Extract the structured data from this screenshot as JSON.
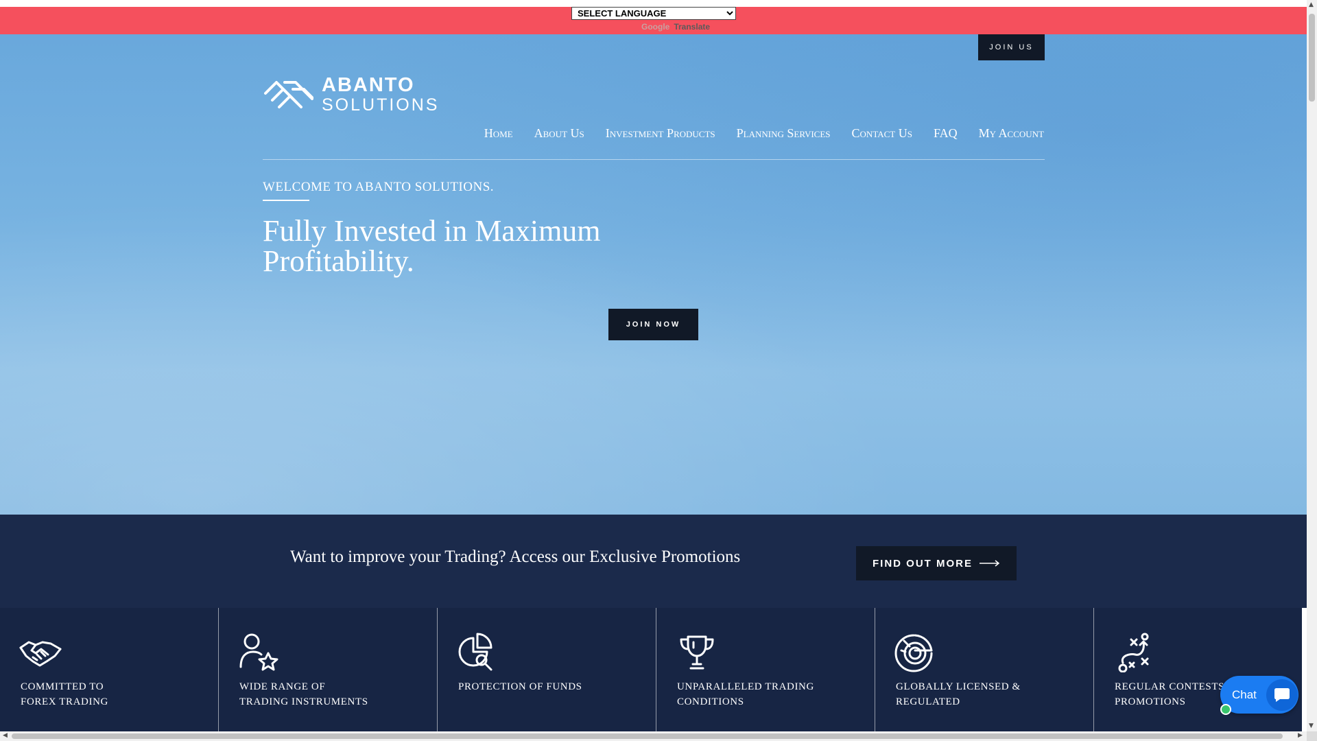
{
  "translate": {
    "select_value": "SELECT LANGUAGE",
    "powered_prefix": "Google",
    "powered_label": "Translate"
  },
  "header": {
    "join_us": "JOIN US",
    "logo_line1": "ABANTO",
    "logo_line2": "SOLUTIONS",
    "nav": [
      "Home",
      "About Us",
      "Investment Products",
      "Planning Services",
      "Contact Us",
      "FAQ",
      "My Account"
    ]
  },
  "hero": {
    "welcome": "WELCOME TO ABANTO SOLUTIONS.",
    "headline": "Fully Invested in Maximum Profitability.",
    "cta": "JOIN NOW"
  },
  "promo": {
    "text": "Want to improve your Trading? Access our Exclusive Promotions",
    "button": "FIND OUT MORE"
  },
  "features": [
    {
      "label": "COMMITTED TO\nFOREX TRADING",
      "icon": "handshake-icon"
    },
    {
      "label": "WIDE RANGE OF\nTRADING INSTRUMENTS",
      "icon": "user-star-icon"
    },
    {
      "label": "PROTECTION OF FUNDS",
      "icon": "pie-search-icon"
    },
    {
      "label": "UNPARALLELED TRADING\nCONDITIONS",
      "icon": "trophy-icon"
    },
    {
      "label": "GLOBALLY LICENSED &\nREGULATED",
      "icon": "globe-chart-icon"
    },
    {
      "label": "REGULAR CONTESTS &\nPROMOTIONS",
      "icon": "strategy-icon"
    }
  ],
  "chat": {
    "label": "Chat"
  },
  "colors": {
    "translate_bar": "#f5505d",
    "dark_button": "#111927",
    "promo_band": "#1b2a4b",
    "features_band": "#172544",
    "chat_blue": "#1b7cf2"
  }
}
